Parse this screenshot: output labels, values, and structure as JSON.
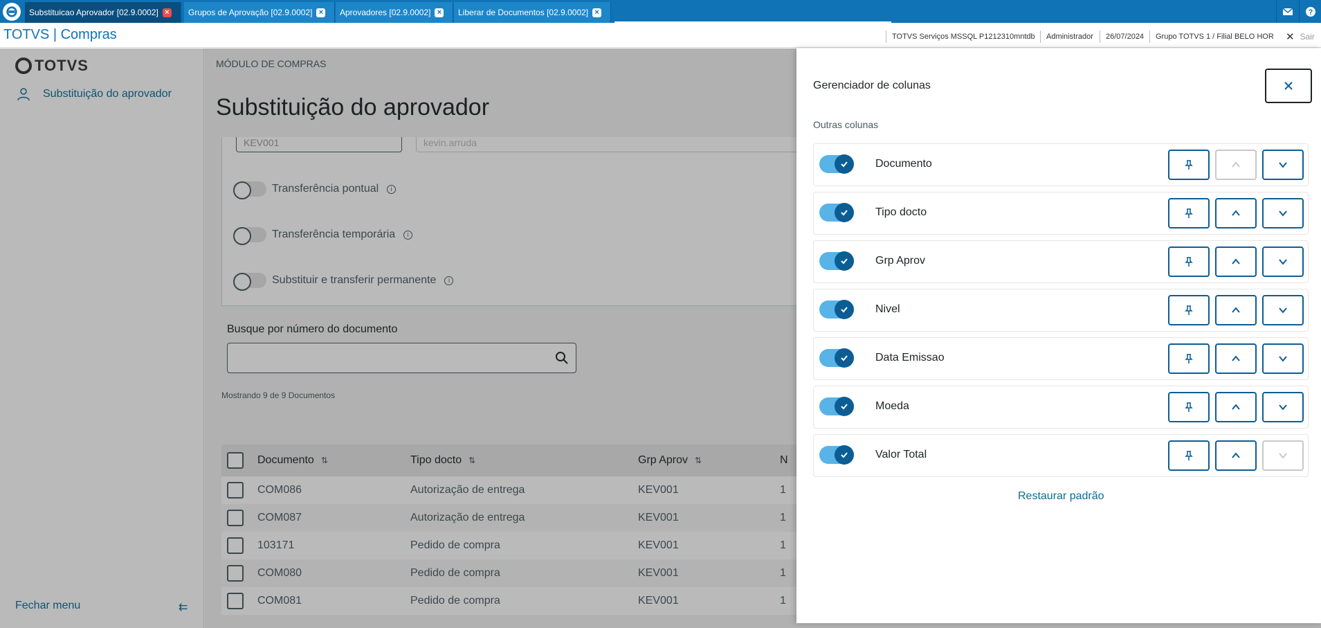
{
  "tabs": [
    {
      "label": "Substituicao Aprovador [02.9.0002]",
      "active": true
    },
    {
      "label": "Grupos de Aprovação [02.9.0002]",
      "active": false
    },
    {
      "label": "Aprovadores [02.9.0002]",
      "active": false
    },
    {
      "label": "Liberar de Documentos [02.9.0002]",
      "active": false
    }
  ],
  "header": {
    "app_title": "TOTVS | Compras",
    "server": "TOTVS Serviços MSSQL P1212310mntdb",
    "user": "Administrador",
    "date": "26/07/2024",
    "branch": "Grupo TOTVS 1 / Filial BELO HOR",
    "logout": "Sair"
  },
  "sidebar": {
    "logo": "TOTVS",
    "item": "Substituição do aprovador",
    "close_menu": "Fechar menu"
  },
  "main": {
    "breadcrumb": "MÓDULO DE COMPRAS",
    "title": "Substituição do aprovador",
    "field_code": "KEV001",
    "field_name": "kevin.arruda",
    "switches": [
      "Transferência pontual",
      "Transferência temporária",
      "Substituir e transferir permanente"
    ],
    "search_label": "Busque por número do documento",
    "showing": "Mostrando 9 de 9 Documentos",
    "table": {
      "headers": [
        "Documento",
        "Tipo docto",
        "Grp Aprov",
        "N"
      ],
      "rows": [
        [
          "COM086",
          "Autorização de entrega",
          "KEV001",
          "1"
        ],
        [
          "COM087",
          "Autorização de entrega",
          "KEV001",
          "1"
        ],
        [
          "103171",
          "Pedido de compra",
          "KEV001",
          "1"
        ],
        [
          "COM080",
          "Pedido de compra",
          "KEV001",
          "1"
        ],
        [
          "COM081",
          "Pedido de compra",
          "KEV001",
          "1"
        ]
      ]
    }
  },
  "drawer": {
    "title": "Gerenciador de colunas",
    "section": "Outras colunas",
    "columns": [
      {
        "label": "Documento",
        "up_disabled": true,
        "down_disabled": false
      },
      {
        "label": "Tipo docto",
        "up_disabled": false,
        "down_disabled": false
      },
      {
        "label": "Grp Aprov",
        "up_disabled": false,
        "down_disabled": false
      },
      {
        "label": "Nivel",
        "up_disabled": false,
        "down_disabled": false
      },
      {
        "label": "Data Emissao",
        "up_disabled": false,
        "down_disabled": false
      },
      {
        "label": "Moeda",
        "up_disabled": false,
        "down_disabled": false
      },
      {
        "label": "Valor Total",
        "up_disabled": false,
        "down_disabled": true
      }
    ],
    "restore": "Restaurar padrão"
  },
  "colors": {
    "primary": "#0f73b6",
    "accent": "#0c5d94",
    "toggle": "#58b3e7"
  }
}
